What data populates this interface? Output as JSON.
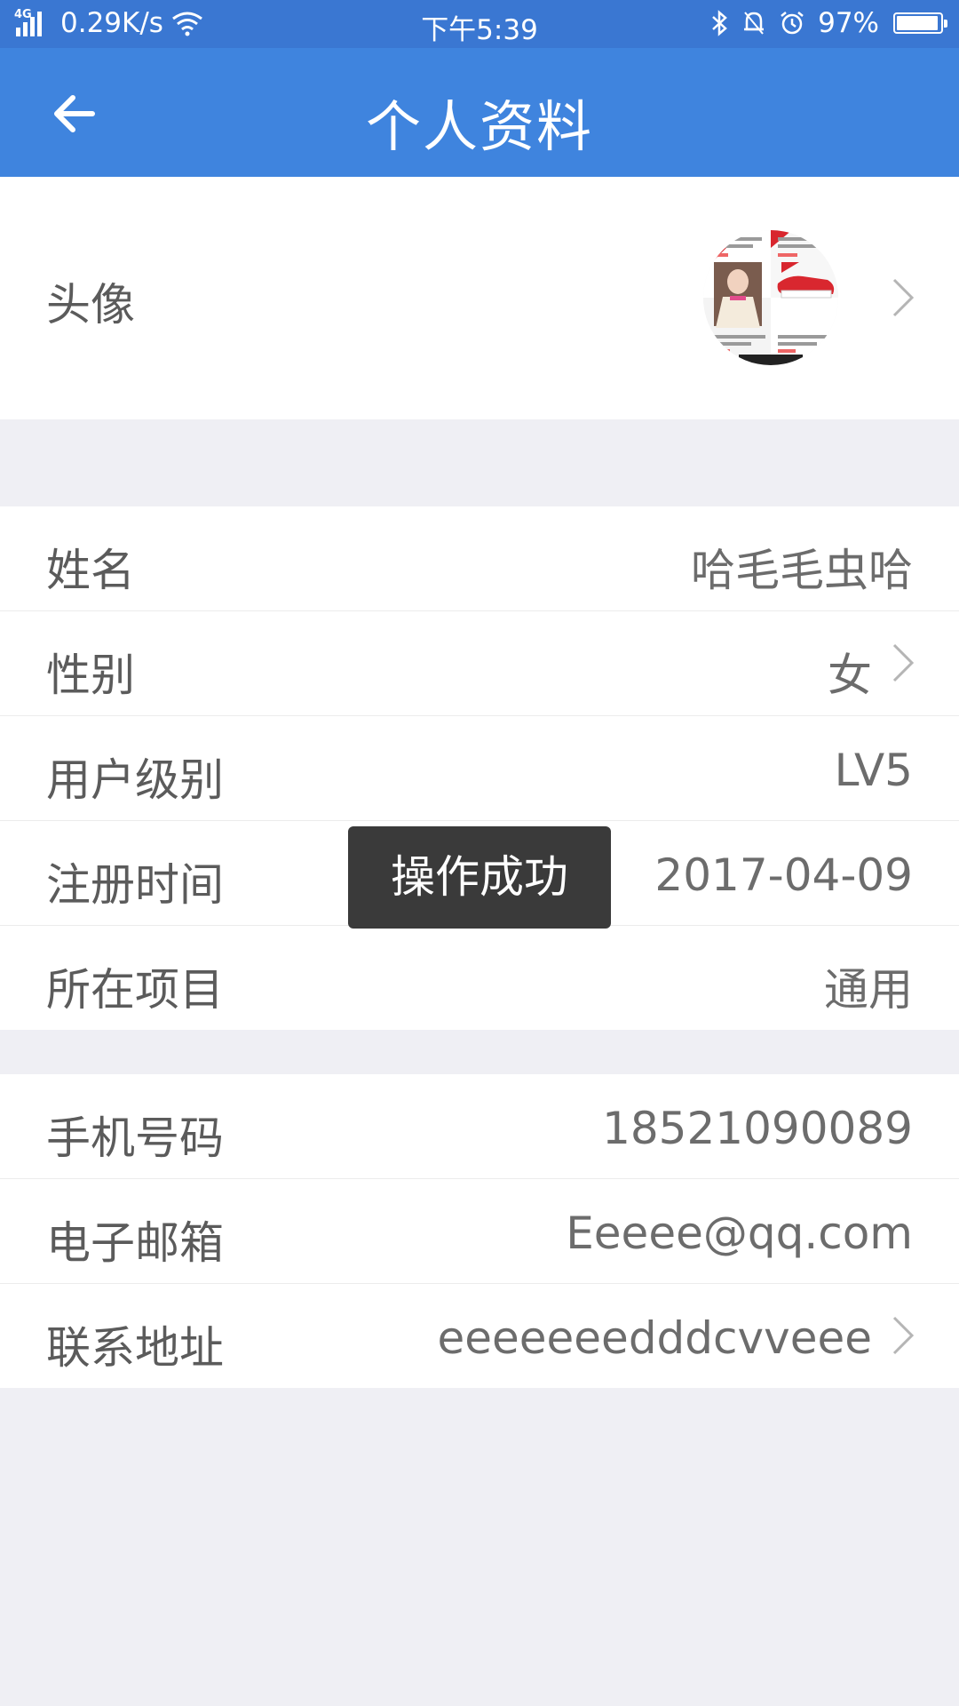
{
  "status_bar": {
    "network": "4G",
    "speed": "0.29K/s",
    "time": "下午5:39",
    "battery": "97%",
    "icons": [
      "signal-icon",
      "wifi-icon",
      "bluetooth-icon",
      "bell-icon",
      "alarm-icon",
      "battery-icon"
    ]
  },
  "nav": {
    "back_icon": "arrow-left-icon",
    "title": "个人资料"
  },
  "avatar_row": {
    "label": "头像"
  },
  "section_basic": [
    {
      "label": "姓名",
      "value": "哈毛毛虫哈"
    },
    {
      "label": "性别",
      "value": "女"
    },
    {
      "label": "用户级别",
      "value": "LV5"
    },
    {
      "label": "注册时间",
      "value": "2017-04-09"
    },
    {
      "label": "所在项目",
      "value": "通用"
    }
  ],
  "section_contact": [
    {
      "label": "手机号码",
      "value": "18521090089"
    },
    {
      "label": "电子邮箱",
      "value": "Eeeee@qq.com"
    },
    {
      "label": "联系地址",
      "value": "eeeeeeedddcvveee"
    }
  ],
  "toast": "操作成功",
  "colors": {
    "status_bar": "#3a77d2",
    "nav_bar": "#3f84de",
    "page_bg": "#efeff4",
    "label_text": "#5b5b5b",
    "value_text": "#6c6c6c"
  }
}
